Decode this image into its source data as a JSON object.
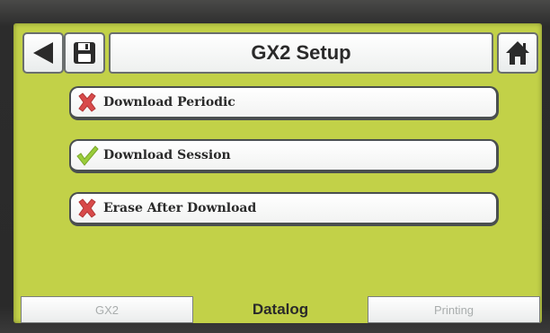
{
  "header": {
    "title": "GX2 Setup",
    "back_icon": "back-arrow-icon",
    "save_icon": "floppy-disk-icon",
    "home_icon": "home-icon"
  },
  "options": [
    {
      "label": "Download Periodic",
      "checked": false,
      "icon": "red-x-icon"
    },
    {
      "label": "Download Session",
      "checked": true,
      "icon": "green-check-icon"
    },
    {
      "label": "Erase After Download",
      "checked": false,
      "icon": "red-x-icon"
    }
  ],
  "tabs": [
    {
      "label": "GX2",
      "active": false
    },
    {
      "label": "Datalog",
      "active": true
    },
    {
      "label": "Printing",
      "active": false
    }
  ],
  "colors": {
    "screen": "#c2d148",
    "x_mark": "#d84a4a",
    "check_mark": "#9acd3a"
  }
}
